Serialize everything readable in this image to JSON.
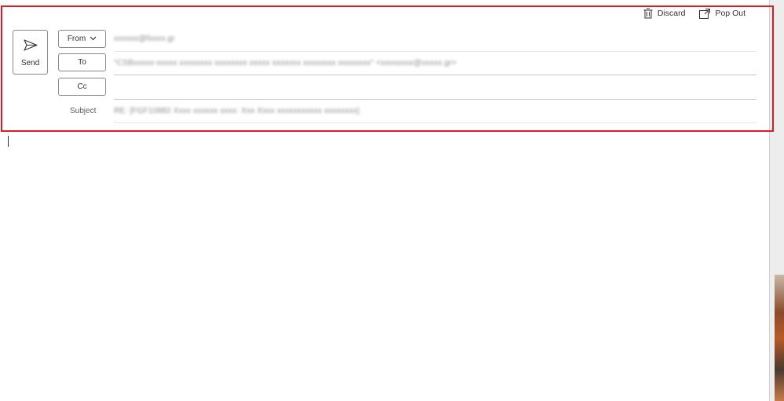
{
  "actions": {
    "discard_label": "Discard",
    "pop_out_label": "Pop Out"
  },
  "send": {
    "label": "Send"
  },
  "from": {
    "button_label": "From",
    "value": "xxxxxx@fxxxx.gr"
  },
  "to": {
    "button_label": "To",
    "value": "\"CSBxxxxx-xxxxx xxxxxxxx xxxxxxxx xxxxx xxxxxxx xxxxxxxx xxxxxxxx\" <xxxxxxxx@xxxxx.gr>"
  },
  "cc": {
    "button_label": "Cc",
    "value": ""
  },
  "subject": {
    "label": "Subject",
    "value": "RE: [FGF10882 Xxxx xxxxxx xxxx: Xxx Xxxx xxxxxxxxxxx xxxxxxxx]"
  },
  "colors": {
    "highlight": "#e01b24",
    "border": "#8a8886"
  }
}
